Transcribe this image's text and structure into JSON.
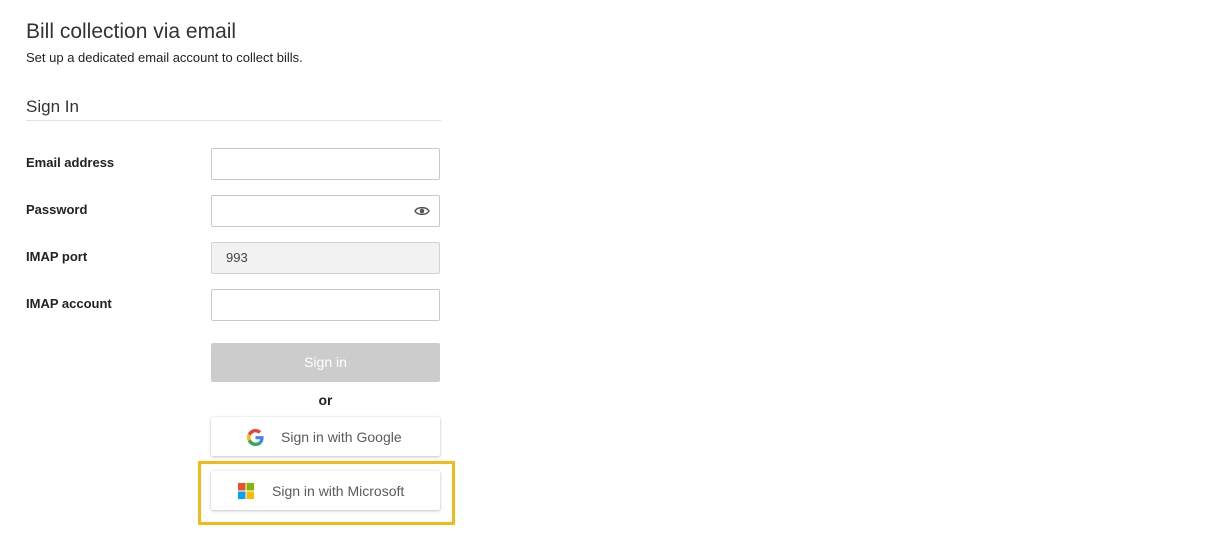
{
  "header": {
    "title": "Bill collection via email",
    "subtitle": "Set up a dedicated email account to collect bills."
  },
  "section": {
    "title": "Sign In"
  },
  "form": {
    "email": {
      "label": "Email address",
      "value": "",
      "placeholder": ""
    },
    "password": {
      "label": "Password",
      "value": "",
      "placeholder": "",
      "icon": "eye-icon"
    },
    "imap_port": {
      "label": "IMAP port",
      "value": "993"
    },
    "imap_account": {
      "label": "IMAP account",
      "value": "",
      "placeholder": ""
    }
  },
  "actions": {
    "sign_in_label": "Sign in",
    "or_label": "or",
    "google_label": "Sign in with Google",
    "microsoft_label": "Sign in with Microsoft"
  },
  "colors": {
    "highlight": "#f5b914",
    "disabled_button": "#cccccc",
    "google_blue": "#4285F4",
    "google_red": "#EA4335",
    "google_yellow": "#FBBC05",
    "google_green": "#34A853",
    "ms_red": "#F25022",
    "ms_green": "#7FBA00",
    "ms_blue": "#00A4EF",
    "ms_yellow": "#FFB900"
  }
}
